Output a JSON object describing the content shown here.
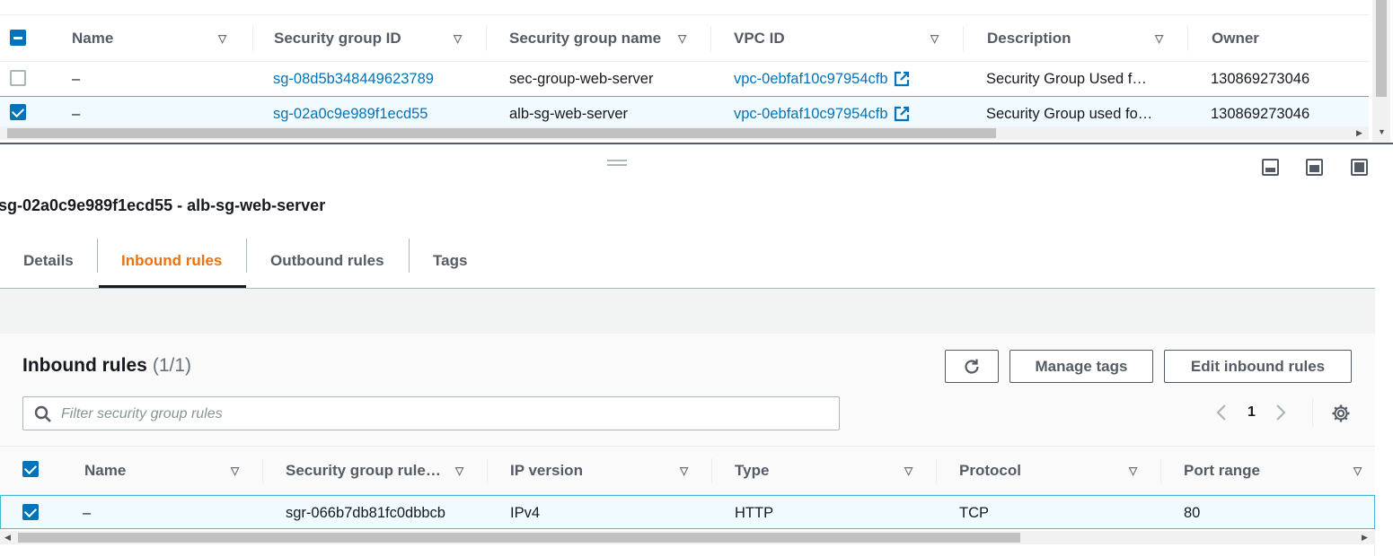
{
  "top_table": {
    "columns": [
      {
        "label": "Name"
      },
      {
        "label": "Security group ID"
      },
      {
        "label": "Security group name"
      },
      {
        "label": "VPC ID"
      },
      {
        "label": "Description"
      },
      {
        "label": "Owner"
      }
    ],
    "rows": [
      {
        "selected": false,
        "name": "–",
        "sg_id": "sg-08d5b348449623789",
        "sg_name": "sec-group-web-server",
        "vpc_id": "vpc-0ebfaf10c97954cfb",
        "description": "Security Group Used f…",
        "owner": "130869273046"
      },
      {
        "selected": true,
        "name": "–",
        "sg_id": "sg-02a0c9e989f1ecd55",
        "sg_name": "alb-sg-web-server",
        "vpc_id": "vpc-0ebfaf10c97954cfb",
        "description": "Security Group used fo…",
        "owner": "130869273046"
      }
    ]
  },
  "panel": {
    "title": "sg-02a0c9e989f1ecd55 - alb-sg-web-server",
    "tabs": [
      {
        "label": "Details",
        "active": false
      },
      {
        "label": "Inbound rules",
        "active": true
      },
      {
        "label": "Outbound rules",
        "active": false
      },
      {
        "label": "Tags",
        "active": false
      }
    ]
  },
  "inbound": {
    "heading": "Inbound rules",
    "count": "(1/1)",
    "refresh_icon": "refresh-icon",
    "manage_tags_label": "Manage tags",
    "edit_label": "Edit inbound rules",
    "filter_placeholder": "Filter security group rules",
    "page": "1",
    "columns": [
      {
        "label": "Name"
      },
      {
        "label": "Security group rule…"
      },
      {
        "label": "IP version"
      },
      {
        "label": "Type"
      },
      {
        "label": "Protocol"
      },
      {
        "label": "Port range"
      }
    ],
    "rows": [
      {
        "selected": true,
        "name": "–",
        "rule_id": "sgr-066b7db81fc0dbbcb",
        "ip_version": "IPv4",
        "type": "HTTP",
        "protocol": "TCP",
        "port_range": "80"
      }
    ]
  },
  "colors": {
    "link": "#0073bb",
    "active_tab": "#ec7211",
    "checkbox": "#0073bb",
    "selected_row_bg": "#f1faff",
    "selected_row_border": "#44b9d6"
  }
}
